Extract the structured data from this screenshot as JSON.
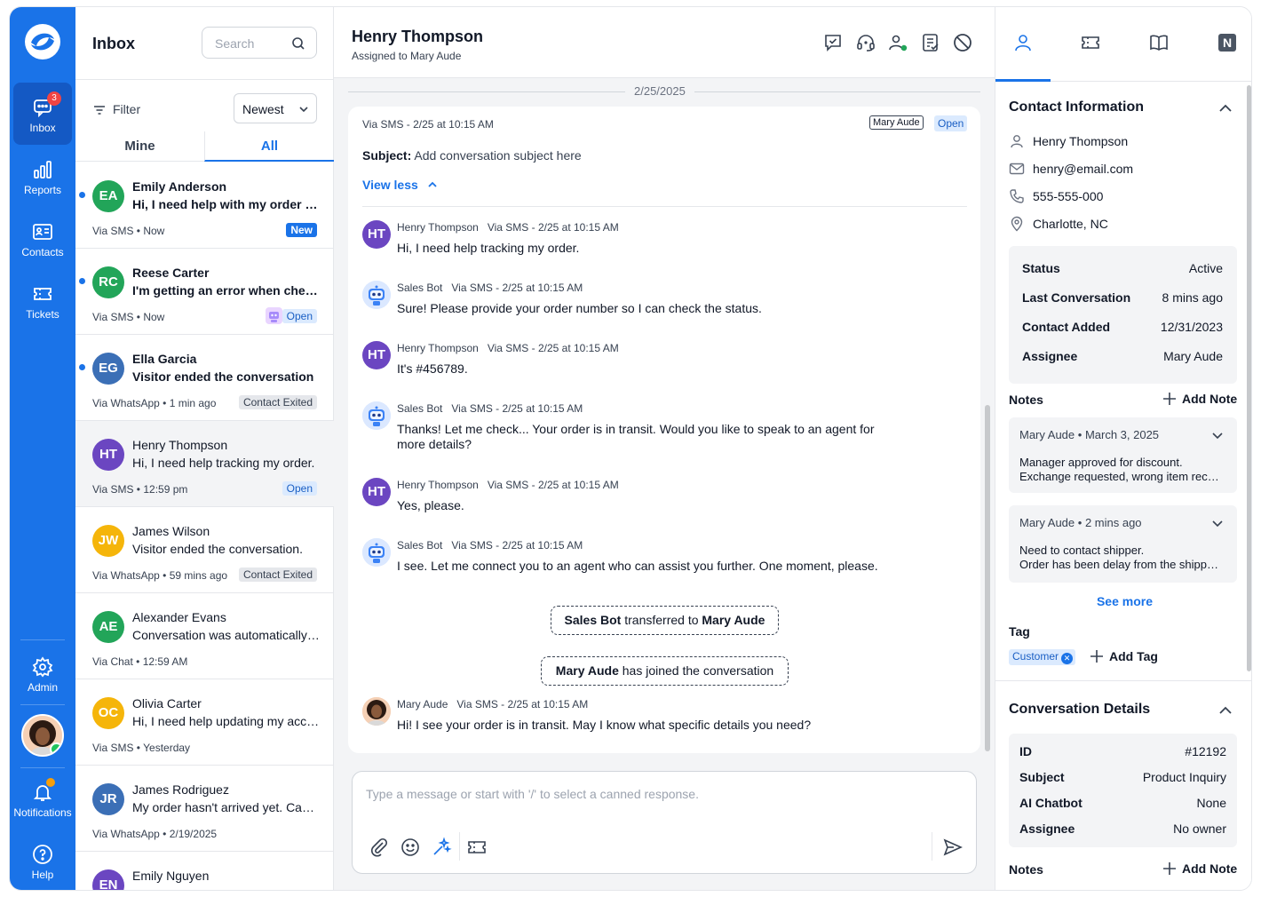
{
  "nav": {
    "items": [
      {
        "label": "Inbox",
        "badge": "3"
      },
      {
        "label": "Reports"
      },
      {
        "label": "Contacts"
      },
      {
        "label": "Tickets"
      },
      {
        "label": "Admin"
      },
      {
        "label": "Notifications"
      },
      {
        "label": "Help"
      }
    ]
  },
  "inbox": {
    "title": "Inbox",
    "search_placeholder": "Search",
    "filter_label": "Filter",
    "sort_value": "Newest",
    "tabs": [
      "Mine",
      "All"
    ],
    "conversations": [
      {
        "initials": "EA",
        "name": "Emily Anderson",
        "preview": "Hi, I need help with my order status",
        "channel": "Via SMS",
        "time": "Now",
        "tag": "New",
        "color": "#22a559",
        "unread": true
      },
      {
        "initials": "RC",
        "name": "Reese Carter",
        "preview": "I'm getting an error when checking out",
        "channel": "Via SMS",
        "time": "Now",
        "tag": "Open",
        "color": "#22a559",
        "unread": true
      },
      {
        "initials": "EG",
        "name": "Ella Garcia",
        "preview": "Visitor ended the conversation",
        "channel": "Via WhatsApp",
        "time": "1 min ago",
        "tag": "Contact Exited",
        "color": "#3b6fb6",
        "unread": true
      },
      {
        "initials": "HT",
        "name": "Henry Thompson",
        "preview": "Hi, I need help tracking my order.",
        "channel": "Via SMS",
        "time": "12:59 pm",
        "tag": "Open",
        "color": "#6b46c1",
        "unread": false
      },
      {
        "initials": "JW",
        "name": "James Wilson",
        "preview": "Visitor ended the conversation.",
        "channel": "Via WhatsApp",
        "time": "59 mins ago",
        "tag": "Contact Exited",
        "color": "#f5b50a",
        "unread": false
      },
      {
        "initials": "AE",
        "name": "Alexander Evans",
        "preview": "Conversation was automatically closed",
        "channel": "Via Chat",
        "time": "12:59 AM",
        "tag": "",
        "color": "#22a559",
        "unread": false
      },
      {
        "initials": "OC",
        "name": "Olivia Carter",
        "preview": "Hi, I need help updating my account",
        "channel": "Via SMS",
        "time": "Yesterday",
        "tag": "",
        "color": "#f5b50a",
        "unread": false
      },
      {
        "initials": "JR",
        "name": "James Rodriguez",
        "preview": "My order hasn't arrived yet. Can you help?",
        "channel": "Via WhatsApp",
        "time": "2/19/2025",
        "tag": "",
        "color": "#3b6fb6",
        "unread": false
      },
      {
        "initials": "EN",
        "name": "Emily Nguyen",
        "preview": "",
        "channel": "",
        "time": "",
        "tag": "",
        "color": "#6b46c1",
        "unread": false
      }
    ]
  },
  "main": {
    "contact_name": "Henry Thompson",
    "assigned": "Assigned to Mary Aude",
    "date_separator": "2/25/2025",
    "card_meta": "Via SMS - 2/25 at 10:15 AM",
    "assignee_chip": "Mary Aude",
    "status_chip": "Open",
    "subject_label": "Subject:",
    "subject_value": "Add conversation subject here",
    "view_less": "View less",
    "messages": [
      {
        "sender": "Henry Thompson",
        "meta": "Via SMS - 2/25 at 10:15 AM",
        "text": "Hi, I need help tracking my order.",
        "type": "user"
      },
      {
        "sender": "Sales Bot",
        "meta": "Via SMS - 2/25 at 10:15 AM",
        "text": "Sure! Please provide your order number so I can check the status.",
        "type": "bot"
      },
      {
        "sender": "Henry Thompson",
        "meta": "Via SMS - 2/25 at 10:15 AM",
        "text": "It's #456789.",
        "type": "user"
      },
      {
        "sender": "Sales Bot",
        "meta": "Via SMS - 2/25 at 10:15 AM",
        "text": "Thanks! Let me check... Your order is in transit. Would you like to speak to an agent for more details?",
        "type": "bot"
      },
      {
        "sender": "Henry Thompson",
        "meta": "Via SMS - 2/25 at 10:15 AM",
        "text": "Yes, please.",
        "type": "user"
      },
      {
        "sender": "Sales Bot",
        "meta": "Via SMS - 2/25 at 10:15 AM",
        "text": "I see. Let me connect you to an agent who can assist you further. One moment, please.",
        "type": "bot"
      },
      {
        "sender": "Mary Aude",
        "meta": "Via SMS - 2/25 at 10:15 AM",
        "text": "Hi! I see your order is in transit. May I know what specific details you need?",
        "type": "agent"
      }
    ],
    "system_events": [
      {
        "a": "Sales Bot",
        "mid": " transferred to ",
        "b": "Mary Aude",
        "end": ""
      },
      {
        "a": "Mary Aude",
        "mid": " has joined the conversation",
        "b": "",
        "end": ""
      }
    ],
    "composer_placeholder": "Type a message or start with '/' to select a canned response."
  },
  "right": {
    "contact_info_title": "Contact Information",
    "contact": {
      "name": "Henry Thompson",
      "email": "henry@email.com",
      "phone": "555-555-000",
      "location": "Charlotte, NC"
    },
    "stats": [
      {
        "k": "Status",
        "v": "Active"
      },
      {
        "k": "Last Conversation",
        "v": "8 mins ago"
      },
      {
        "k": "Contact Added",
        "v": "12/31/2023"
      },
      {
        "k": "Assignee",
        "v": "Mary Aude"
      }
    ],
    "notes_label": "Notes",
    "add_note": "Add Note",
    "notes": [
      {
        "author": "Mary Aude",
        "when": "March 3, 2025",
        "line1": "Manager approved for discount.",
        "line2": "Exchange requested, wrong item received"
      },
      {
        "author": "Mary Aude",
        "when": "2 mins ago",
        "line1": "Need to contact shipper.",
        "line2": "Order has been delay from the shipping center"
      }
    ],
    "see_more": "See more",
    "tag_label": "Tag",
    "tags": [
      "Customer"
    ],
    "add_tag": "Add Tag",
    "conv_details_title": "Conversation Details",
    "details": [
      {
        "k": "ID",
        "v": "#12192"
      },
      {
        "k": "Subject",
        "v": "Product Inquiry"
      },
      {
        "k": "AI Chatbot",
        "v": "None"
      },
      {
        "k": "Assignee",
        "v": "No owner"
      }
    ],
    "notes_label2": "Notes",
    "add_note2": "Add Note",
    "n_tab_letter": "N"
  },
  "colors": {
    "brand": "#1a73e8",
    "brand_dark": "#1459c4",
    "badge": "#ef4444",
    "online": "#22c55e"
  }
}
